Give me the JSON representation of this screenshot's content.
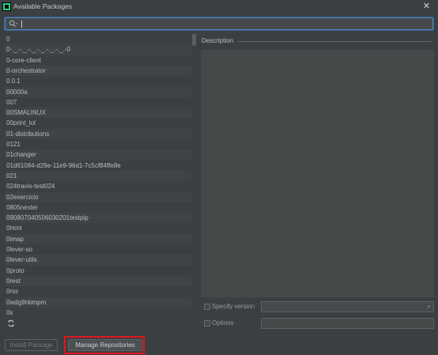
{
  "window": {
    "title": "Available Packages",
    "close_glyph": "✕",
    "icon": "pycharm-icon"
  },
  "search": {
    "value": "",
    "placeholder": "",
    "icon": "search-icon"
  },
  "packages": [
    "0",
    "0-._.-._.-._.-._.-._.-._.-0",
    "0-core-client",
    "0-orchestrator",
    "0.0.1",
    "00000a",
    "007",
    "00SMALINUX",
    "00print_lol",
    "01-distributions",
    "0121",
    "01changer",
    "01d61084-d29e-11e9-96d1-7c5cf84ffe8e",
    "021",
    "024travis-test024",
    "02exercicio",
    "0805nexter",
    "090807040506030201testpip",
    "0html",
    "0imap",
    "0lever-so",
    "0lever-utils",
    "0proto",
    "0rest",
    "0rss",
    "0wdg9nbmpm",
    "0x"
  ],
  "description": {
    "label": "Description",
    "text": ""
  },
  "options": {
    "specify_version_label": "Specify version",
    "specify_version_checked": false,
    "specify_version_value": "",
    "options_label": "Options",
    "options_checked": false,
    "options_value": ""
  },
  "buttons": {
    "install_label": "Install Package",
    "manage_label": "Manage Repositories"
  },
  "refresh_icon": "refresh-icon",
  "colors": {
    "background": "#3c3f41",
    "field": "#45494a",
    "focus_border": "#4a88c7",
    "highlight_border": "#e0171d"
  }
}
